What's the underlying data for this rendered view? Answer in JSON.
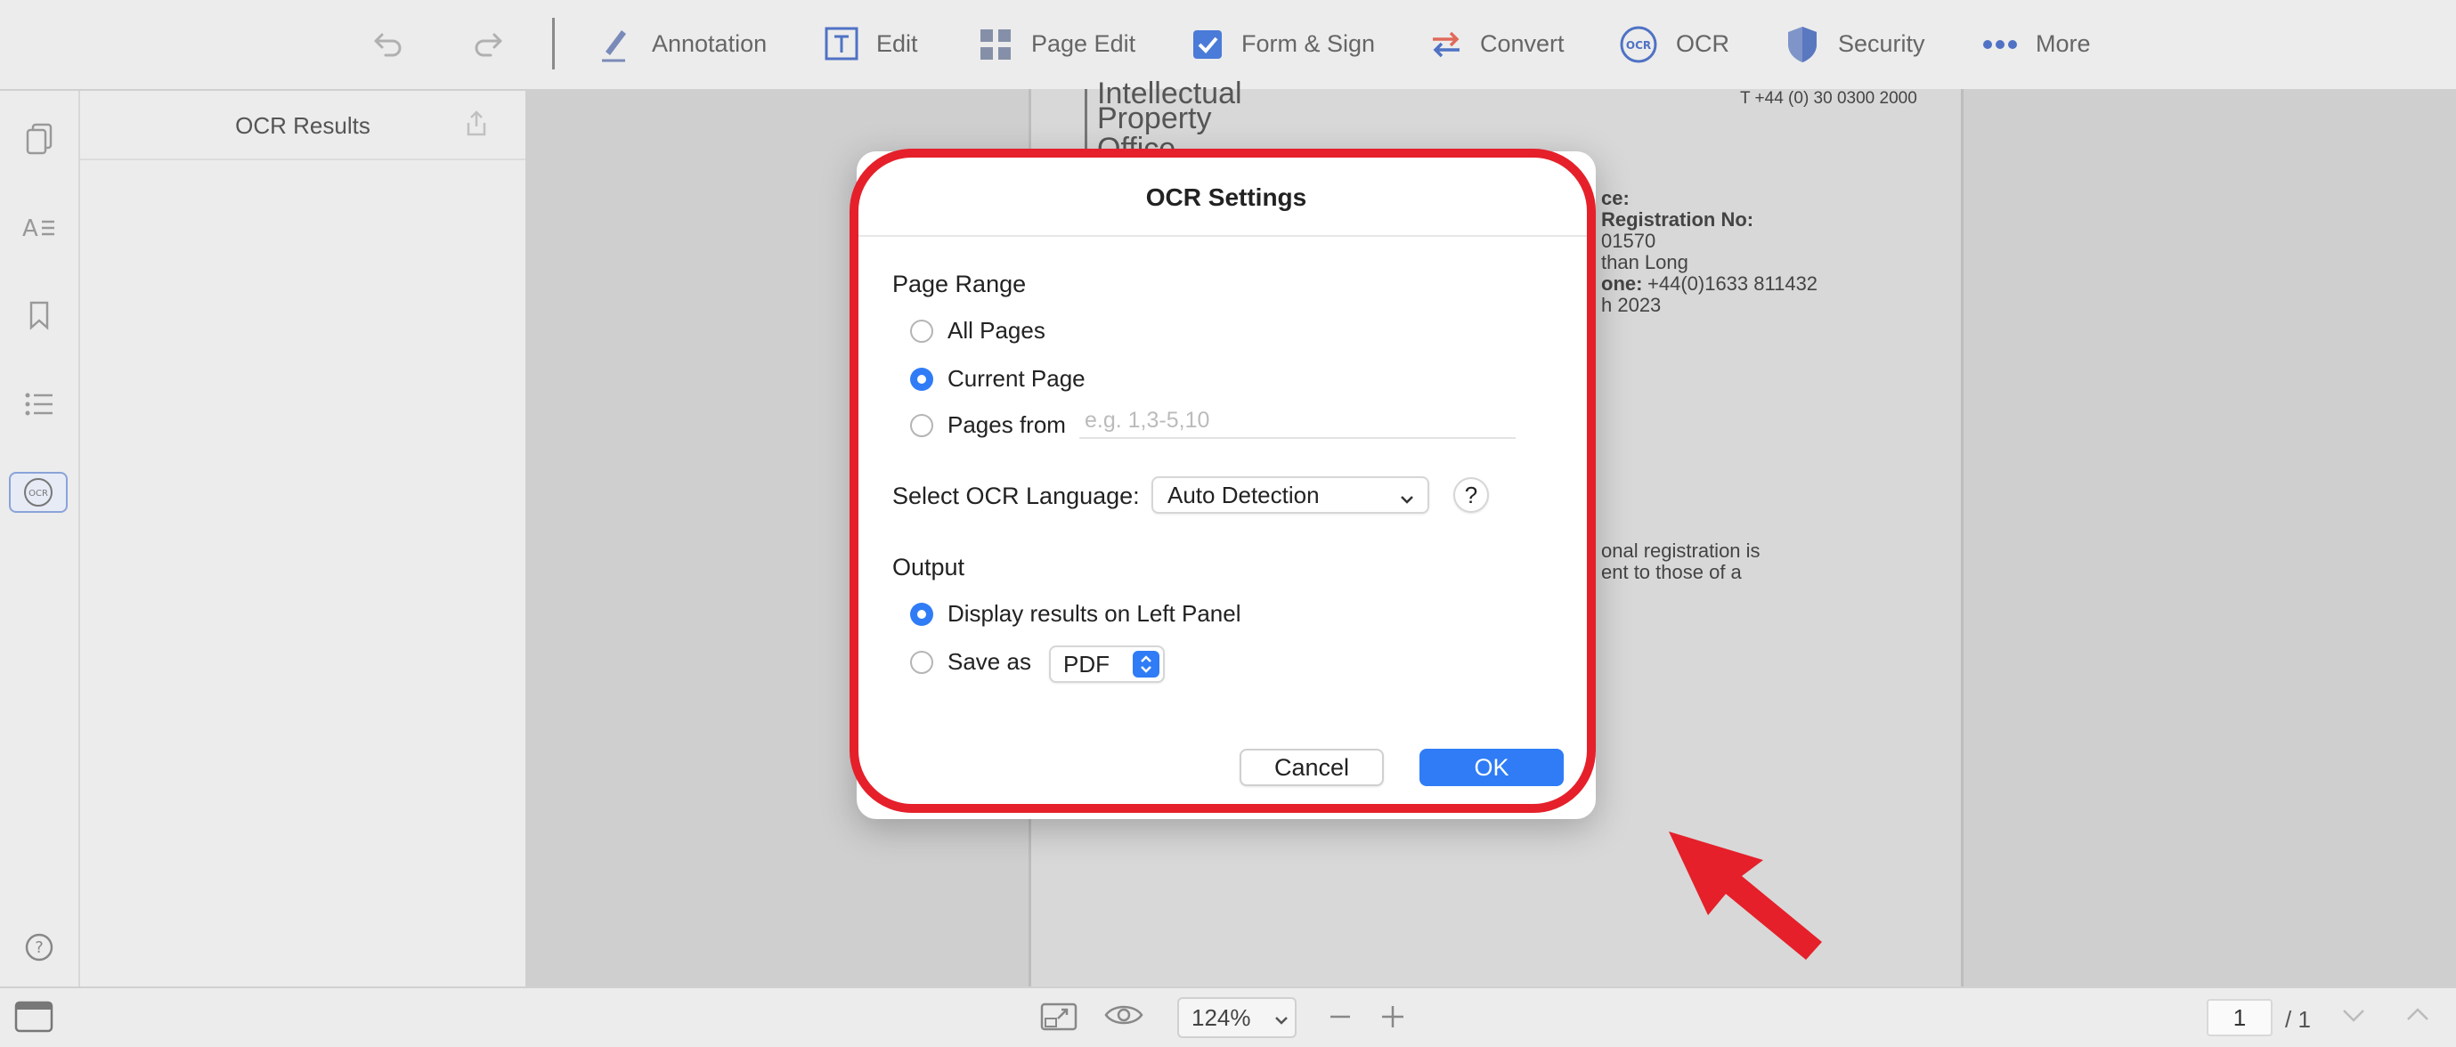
{
  "toolbar": {
    "annotation": "Annotation",
    "edit": "Edit",
    "page_edit": "Page Edit",
    "form_sign": "Form & Sign",
    "convert": "Convert",
    "ocr": "OCR",
    "security": "Security",
    "more": "More"
  },
  "panel": {
    "title": "OCR Results"
  },
  "document": {
    "brand_line1": "Intellectual",
    "brand_line2": "Property",
    "brand_line3": "Office",
    "phone_top": "T   +44 (0) 30 0300 2000",
    "line_ce": "ce:",
    "line_reg": "Registration No:",
    "line_num": "01570",
    "line_name": "than Long",
    "line_phone_label": "one:",
    "line_phone": "+44(0)1633 811432",
    "line_date": "h 2023",
    "line_para1": "onal registration is",
    "line_para2": "ent to those of a"
  },
  "dialog": {
    "title": "OCR Settings",
    "page_range_label": "Page Range",
    "all_pages": "All Pages",
    "current_page": "Current Page",
    "pages_from": "Pages from",
    "pages_placeholder": "e.g. 1,3-5,10",
    "language_label": "Select OCR Language:",
    "language_value": "Auto Detection",
    "help": "?",
    "output_label": "Output",
    "display_left": "Display results on Left Panel",
    "save_as": "Save as",
    "format_value": "PDF",
    "cancel": "Cancel",
    "ok": "OK"
  },
  "bottom": {
    "zoom": "124%",
    "page_current": "1",
    "page_total": "/ 1"
  },
  "colors": {
    "accent": "#2f7cf6",
    "highlight": "#e5202a"
  }
}
